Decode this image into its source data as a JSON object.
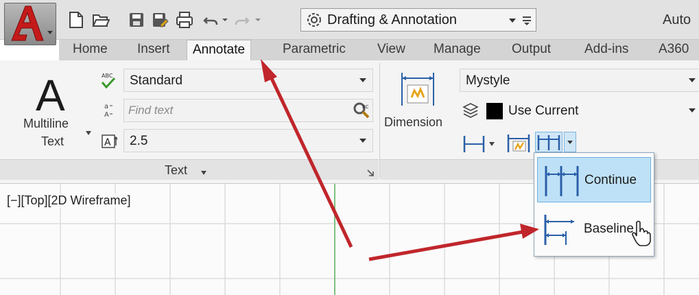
{
  "title_bar": {
    "workspace_selected": "Drafting & Annotation",
    "app_title": "Auto"
  },
  "tabs": [
    {
      "label": "Home"
    },
    {
      "label": "Insert"
    },
    {
      "label": "Annotate",
      "active": true
    },
    {
      "label": "Parametric"
    },
    {
      "label": "View"
    },
    {
      "label": "Manage"
    },
    {
      "label": "Output"
    },
    {
      "label": "Add-ins"
    },
    {
      "label": "A360"
    }
  ],
  "text_panel": {
    "big_letter": "A",
    "multiline_label_1": "Multiline",
    "multiline_label_2": "Text",
    "text_style": "Standard",
    "find_placeholder": "Find text",
    "text_height": "2.5",
    "panel_title": "Text"
  },
  "dimension_panel": {
    "label": "Dimension",
    "dim_style": "Mystyle",
    "layer": "Use Current"
  },
  "flyout": {
    "items": [
      {
        "label": "Continue",
        "icon": "continue-dimension-icon",
        "highlighted": true
      },
      {
        "label": "Baseline",
        "icon": "baseline-dimension-icon",
        "highlighted": false
      }
    ]
  },
  "viewport": {
    "label": "[−][Top][2D Wireframe]"
  },
  "colors": {
    "autocad_red": "#c41a1a",
    "highlight_blue": "#bfe1f7",
    "annotation_arrow": "#c0262b",
    "dimension_blue": "#2a5fa8",
    "dimension_gold": "#e7a51c"
  }
}
